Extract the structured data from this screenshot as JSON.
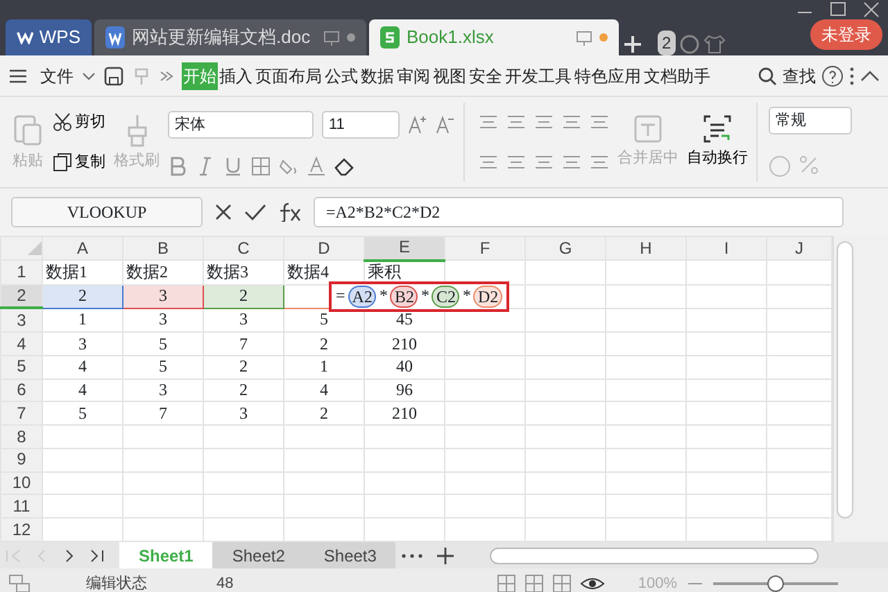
{
  "app_tab": {
    "label": "WPS"
  },
  "doc_tabs": [
    {
      "label": "网站更新编辑文档.doc",
      "kind": "doc",
      "selected": false
    },
    {
      "label": "Book1.xlsx",
      "kind": "sheet",
      "selected": true
    }
  ],
  "tab_count": "2",
  "login_button": "未登录",
  "menu": {
    "file": "文件",
    "tabs": [
      {
        "label": "开始",
        "selected": true
      },
      {
        "label": "插入",
        "selected": false
      },
      {
        "label": "页面布局",
        "selected": false
      },
      {
        "label": "公式",
        "selected": false
      },
      {
        "label": "数据",
        "selected": false
      },
      {
        "label": "审阅",
        "selected": false
      },
      {
        "label": "视图",
        "selected": false
      },
      {
        "label": "安全",
        "selected": false
      },
      {
        "label": "开发工具",
        "selected": false
      },
      {
        "label": "特色应用",
        "selected": false
      },
      {
        "label": "文档助手",
        "selected": false
      }
    ],
    "search": "查找"
  },
  "ribbon": {
    "clipboard": [
      {
        "label": "粘贴",
        "disabled": true
      },
      {
        "label": "剪切",
        "disabled": false
      },
      {
        "label": "复制",
        "disabled": false
      },
      {
        "label": "格式刷",
        "disabled": true
      }
    ],
    "font_name": "宋体",
    "font_size": "11",
    "merge": {
      "label": "合并居中",
      "disabled": true
    },
    "wrap": {
      "label": "自动换行",
      "disabled": false
    },
    "number_format": "常规"
  },
  "formula_bar": {
    "name_box": "VLOOKUP",
    "formula": "=A2*B2*C2*D2"
  },
  "sheet": {
    "columns": [
      {
        "label": "A",
        "selected": false
      },
      {
        "label": "B",
        "selected": false
      },
      {
        "label": "C",
        "selected": false
      },
      {
        "label": "D",
        "selected": false
      },
      {
        "label": "E",
        "selected": true
      },
      {
        "label": "F",
        "selected": false
      },
      {
        "label": "G",
        "selected": false
      },
      {
        "label": "H",
        "selected": false
      },
      {
        "label": "I",
        "selected": false
      },
      {
        "label": "J",
        "selected": false
      }
    ],
    "rows": [
      {
        "number": "1",
        "selected": false,
        "cells": [
          "数据1",
          "数据2",
          "数据3",
          "数据4",
          "乘积"
        ]
      },
      {
        "number": "2",
        "selected": true,
        "cells": [
          {
            "text": "2",
            "color": "#4a7bd0"
          },
          {
            "text": "3",
            "color": "#d9534f"
          },
          {
            "text": "2",
            "color": "#5b9b4a"
          },
          {
            "color": "#ec8a6a"
          }
        ]
      },
      {
        "number": "3",
        "selected": false,
        "cells": [
          "1",
          "3",
          "3",
          "5",
          "45"
        ]
      },
      {
        "number": "4",
        "selected": false,
        "cells": [
          "3",
          "5",
          "7",
          "2",
          "210"
        ]
      },
      {
        "number": "5",
        "selected": false,
        "cells": [
          "4",
          "5",
          "2",
          "1",
          "40"
        ]
      },
      {
        "number": "6",
        "selected": false,
        "cells": [
          "4",
          "3",
          "2",
          "4",
          "96"
        ]
      },
      {
        "number": "7",
        "selected": false,
        "cells": [
          "5",
          "7",
          "3",
          "2",
          "210"
        ]
      },
      {
        "number": "8",
        "selected": false,
        "cells": []
      },
      {
        "number": "9",
        "selected": false,
        "cells": []
      },
      {
        "number": "10",
        "selected": false,
        "cells": []
      },
      {
        "number": "11",
        "selected": false,
        "cells": []
      },
      {
        "number": "12",
        "selected": false,
        "cells": []
      }
    ],
    "edit": {
      "parts": [
        {
          "text": "="
        },
        {
          "text": "A2",
          "color": "#4a7bd0"
        },
        {
          "text": "*"
        },
        {
          "text": "B2",
          "color": "#d9534f"
        },
        {
          "text": "*"
        },
        {
          "text": "C2",
          "color": "#5b9b4a"
        },
        {
          "text": "*"
        },
        {
          "text": "D2",
          "color": "#ec8a6a"
        }
      ]
    }
  },
  "sheets": [
    {
      "label": "Sheet1",
      "selected": true
    },
    {
      "label": "Sheet2",
      "selected": false
    },
    {
      "label": "Sheet3",
      "selected": false
    }
  ],
  "status": {
    "mode": "编辑状态",
    "value": "48",
    "zoom": "100%",
    "zoom_slider": {
      "level": 0.5
    }
  }
}
